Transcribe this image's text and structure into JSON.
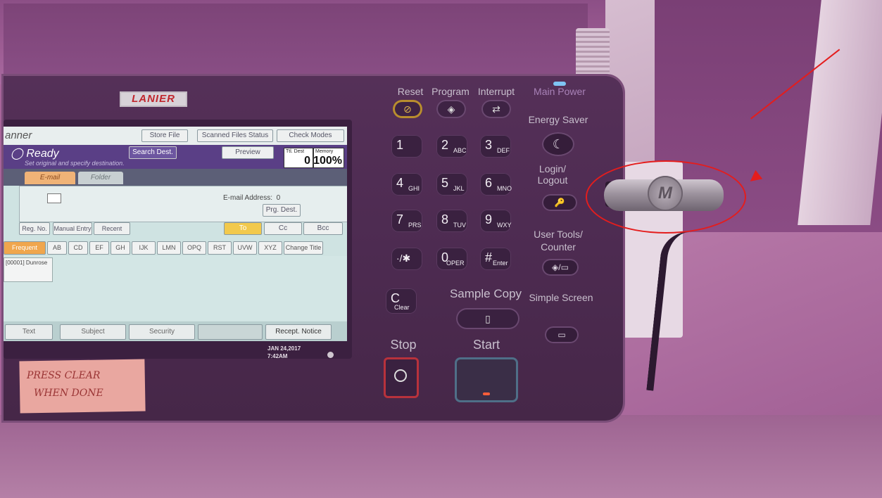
{
  "panel": {
    "brand": "LANIER",
    "hard_keys": {
      "reset": "Reset",
      "program": "Program",
      "interrupt": "Interrupt",
      "main_power": "Main Power",
      "energy_saver": "Energy Saver",
      "login_logout": "Login/ Logout",
      "user_tools_counter": "User Tools/ Counter",
      "simple_screen": "Simple Screen",
      "sample_copy": "Sample Copy",
      "stop": "Stop",
      "start": "Start",
      "clear": "Clear"
    },
    "keypad": [
      {
        "digit": "1",
        "sub": ""
      },
      {
        "digit": "2",
        "sub": "ABC"
      },
      {
        "digit": "3",
        "sub": "DEF"
      },
      {
        "digit": "4",
        "sub": "GHI"
      },
      {
        "digit": "5",
        "sub": "JKL"
      },
      {
        "digit": "6",
        "sub": "MNO"
      },
      {
        "digit": "7",
        "sub": "PRS"
      },
      {
        "digit": "8",
        "sub": "TUV"
      },
      {
        "digit": "9",
        "sub": "WXY"
      },
      {
        "digit": "·/✱",
        "sub": ""
      },
      {
        "digit": "0",
        "sub": "OPER"
      },
      {
        "digit": "#",
        "sub": "Enter"
      },
      {
        "digit": "C",
        "sub": "Clear"
      }
    ]
  },
  "screen": {
    "title": "anner",
    "header_buttons": [
      "Store File",
      "Scanned Files Status",
      "Check Modes"
    ],
    "status": "Ready",
    "status_sub": "Set original and specify destination.",
    "search_dest": "Search Dest.",
    "preview": "Preview",
    "total_dest_label": "Ttl. Dest",
    "total_dest_value": "0",
    "memory_label": "Memory",
    "memory_value": "100%",
    "tabs": [
      "E-mail",
      "Folder"
    ],
    "email_address_label": "E-mail Address:",
    "email_address_count": "0",
    "prg_dest": "Prg. Dest.",
    "row_buttons": [
      "Reg. No.",
      "Manual Entry",
      "Recent"
    ],
    "recipient_buttons": [
      "To",
      "Cc",
      "Bcc"
    ],
    "alpha_tabs": [
      "Frequent",
      "AB",
      "CD",
      "EF",
      "GH",
      "IJK",
      "LMN",
      "OPQ",
      "RST",
      "UVW",
      "XYZ",
      "Change Title"
    ],
    "entry": "[00001] Dunrose",
    "bottom_buttons": [
      "Text",
      "Subject",
      "Security",
      "Recept. Notice"
    ],
    "date": "JAN 24,2017",
    "time": "7:42AM"
  },
  "sticky_note": {
    "line1": "PRESS CLEAR",
    "line2": "WHEN DONE"
  },
  "usb_drive": {
    "logo": "M"
  },
  "colors": {
    "accent": "#e41d1d",
    "screen_header": "#5a3f86",
    "to_button": "#f2c94c"
  }
}
